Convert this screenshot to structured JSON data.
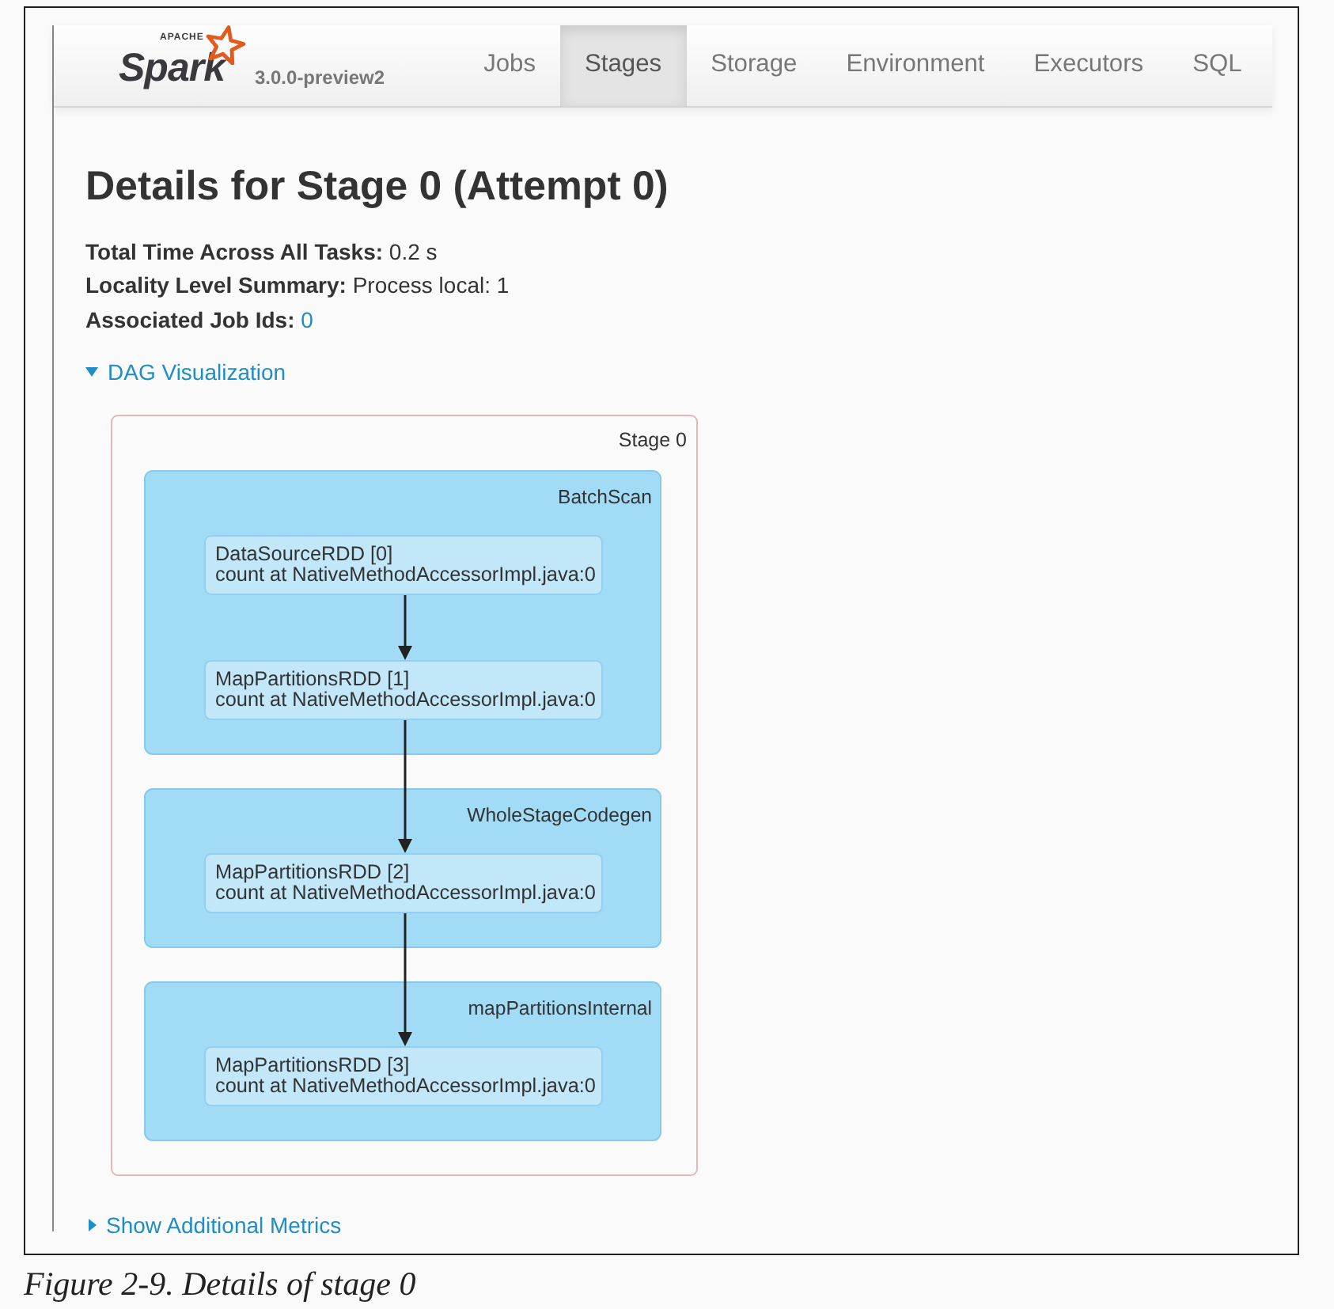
{
  "navbar": {
    "logo": {
      "tagline": "APACHE",
      "wordmark": "Spark"
    },
    "version": "3.0.0-preview2",
    "tabs": [
      {
        "label": "Jobs",
        "selected": false
      },
      {
        "label": "Stages",
        "selected": true
      },
      {
        "label": "Storage",
        "selected": false
      },
      {
        "label": "Environment",
        "selected": false
      },
      {
        "label": "Executors",
        "selected": false
      },
      {
        "label": "SQL",
        "selected": false
      }
    ]
  },
  "page": {
    "title": "Details for Stage 0 (Attempt 0)",
    "summary": [
      {
        "label": "Total Time Across All Tasks:",
        "value": "0.2 s",
        "kind": "text"
      },
      {
        "label": "Locality Level Summary:",
        "value": "Process local: 1",
        "kind": "text"
      },
      {
        "label": "Associated Job Ids:",
        "value": "0",
        "kind": "link"
      }
    ],
    "dag_toggle": {
      "label": "DAG Visualization",
      "expanded": true
    },
    "dag": {
      "stage_label": "Stage 0",
      "clusters": [
        {
          "name": "BatchScan",
          "nodes": [
            {
              "title": "DataSourceRDD [0]",
              "detail": "count at NativeMethodAccessorImpl.java:0"
            },
            {
              "title": "MapPartitionsRDD [1]",
              "detail": "count at NativeMethodAccessorImpl.java:0"
            }
          ]
        },
        {
          "name": "WholeStageCodegen",
          "nodes": [
            {
              "title": "MapPartitionsRDD [2]",
              "detail": "count at NativeMethodAccessorImpl.java:0"
            }
          ]
        },
        {
          "name": "mapPartitionsInternal",
          "nodes": [
            {
              "title": "MapPartitionsRDD [3]",
              "detail": "count at NativeMethodAccessorImpl.java:0"
            }
          ]
        }
      ]
    },
    "metrics_toggle": {
      "label": "Show Additional Metrics",
      "expanded": false
    }
  },
  "caption": "Figure 2-9. Details of stage 0"
}
